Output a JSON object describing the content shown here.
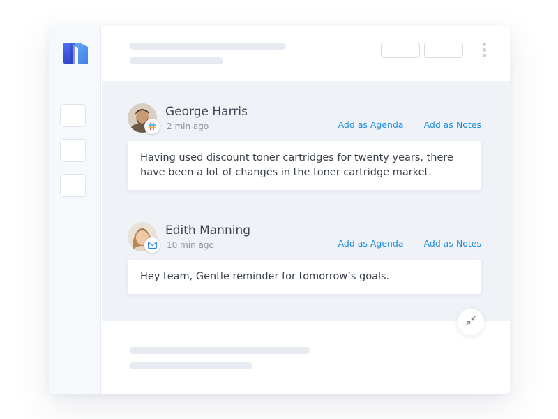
{
  "messages": [
    {
      "author": "George Harris",
      "time": "2 min ago",
      "source_icon": "slack-icon",
      "body": "Having used discount toner cartridges for twenty years, there have been a lot of changes in the toner cartridge market.",
      "action_agenda": "Add as Agenda",
      "action_notes": "Add as Notes"
    },
    {
      "author": "Edith Manning",
      "time": "10 min ago",
      "source_icon": "mail-icon",
      "body": "Hey team, Gentle reminder for tomorrow’s goals.",
      "action_agenda": "Add as Agenda",
      "action_notes": "Add as Notes"
    }
  ],
  "colors": {
    "accent_link": "#1e8fe0",
    "logo_blue": "#3b5bdb",
    "feed_background": "#eff2f7"
  },
  "icons": {
    "logo": "m-logo-icon",
    "collapse": "collapse-arrows-icon",
    "menu": "kebab-menu-icon"
  }
}
